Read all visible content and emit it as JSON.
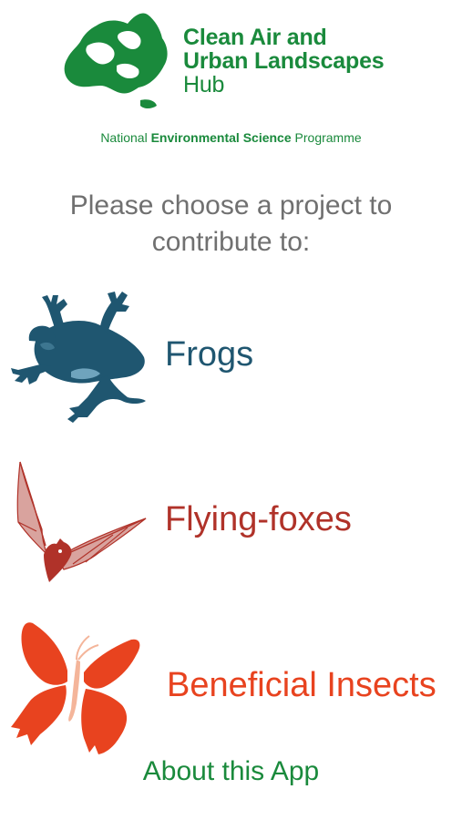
{
  "logo": {
    "line1": "Clean Air and",
    "line2": "Urban Landscapes",
    "line3": "Hub",
    "icon": "australia-map-logo-icon",
    "color": "#1a8a3c"
  },
  "nesp": {
    "part1": "National ",
    "part2": "Environmental Science",
    "part3": " Programme"
  },
  "prompt": {
    "line1": "Please choose a project to",
    "line2": "contribute to:"
  },
  "projects": [
    {
      "label": "Frogs",
      "icon": "frog-icon",
      "color": "#1f5670"
    },
    {
      "label": "Flying-foxes",
      "icon": "flying-fox-icon",
      "color": "#b03229"
    },
    {
      "label": "Beneficial Insects",
      "icon": "butterfly-icon",
      "color": "#e8431f"
    }
  ],
  "about": {
    "label": "About this App"
  }
}
